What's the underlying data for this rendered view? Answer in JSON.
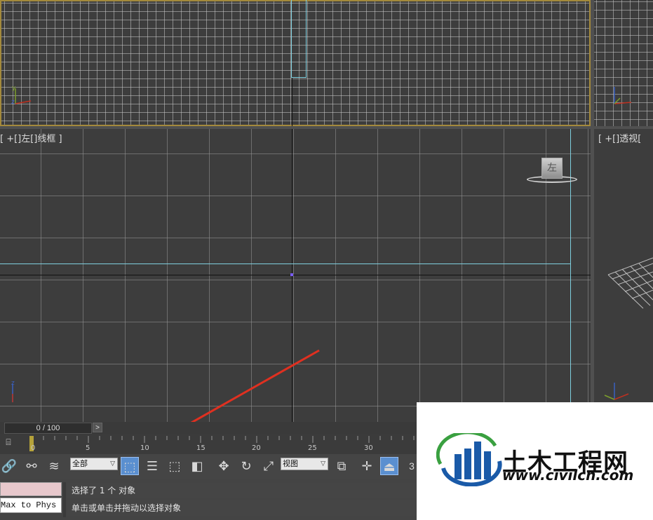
{
  "viewports": {
    "left_label": "[ +[]左[]线框 ]",
    "perspective_label": "[ +[]透视[",
    "viewcube_face": "左",
    "axis_y": "y",
    "axis_z": "z"
  },
  "timeline": {
    "frame": "0 / 100",
    "next": ">",
    "ticks": [
      "0",
      "5",
      "10",
      "15",
      "20",
      "25",
      "30"
    ]
  },
  "toolbar": {
    "selection_filter": "全部",
    "reference_coord": "视图",
    "snap_label": "3",
    "icons": [
      "link-icon",
      "unlink-icon",
      "bind-spacewarp-icon",
      "select-object-icon",
      "select-by-name-icon",
      "rect-region-icon",
      "window-crossing-icon",
      "move-icon",
      "rotate-icon",
      "scale-icon",
      "pivot-icon",
      "manipulate-icon",
      "keyboard-shortcut-icon"
    ]
  },
  "maxscript": {
    "text": "Max to Phys"
  },
  "status": {
    "line1": "选择了 1 个 对象",
    "line2": "单击或单击并拖动以选择对象"
  },
  "watermark": {
    "title": "土木工程网",
    "url": "www.civilcn.com"
  },
  "colors": {
    "active_border": "#a48a3c",
    "arrow": "#e03020",
    "selection_cyan": "#7fd0e0",
    "logo_blue": "#1a5aa8",
    "logo_green": "#3aa040"
  }
}
